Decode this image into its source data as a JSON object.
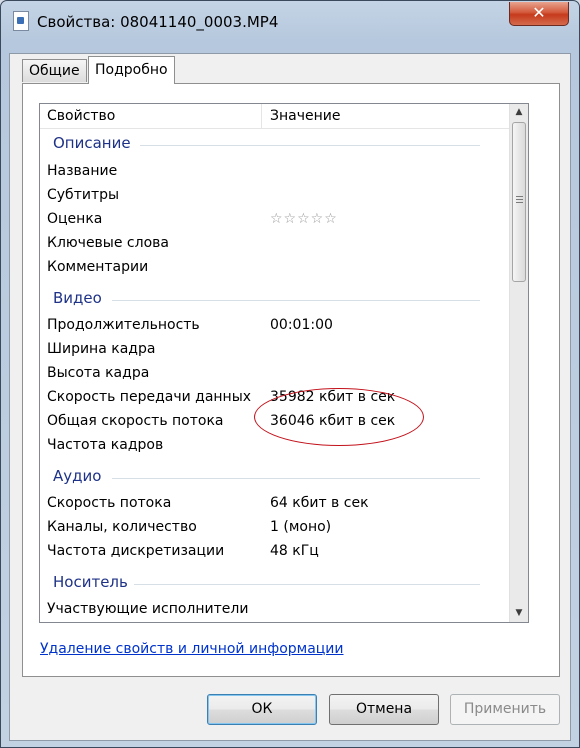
{
  "window": {
    "title": "Свойства: 08041140_0003.MP4",
    "close_glyph": "✕"
  },
  "tabs": [
    {
      "label": "Общие",
      "active": false
    },
    {
      "label": "Подробно",
      "active": true
    }
  ],
  "list": {
    "columns": {
      "property": "Свойство",
      "value": "Значение"
    },
    "groups": {
      "description": {
        "title": "Описание",
        "rows": [
          {
            "name": "Название",
            "value": ""
          },
          {
            "name": "Субтитры",
            "value": ""
          },
          {
            "name": "Оценка",
            "value": "☆☆☆☆☆"
          },
          {
            "name": "Ключевые слова",
            "value": ""
          },
          {
            "name": "Комментарии",
            "value": ""
          }
        ]
      },
      "video": {
        "title": "Видео",
        "rows": [
          {
            "name": "Продолжительность",
            "value": "00:01:00"
          },
          {
            "name": "Ширина кадра",
            "value": ""
          },
          {
            "name": "Высота кадра",
            "value": ""
          },
          {
            "name": "Скорость передачи данных",
            "value": "35982 кбит в сек"
          },
          {
            "name": "Общая скорость потока",
            "value": "36046 кбит в сек"
          },
          {
            "name": "Частота кадров",
            "value": ""
          }
        ]
      },
      "audio": {
        "title": "Аудио",
        "rows": [
          {
            "name": "Скорость потока",
            "value": "64 кбит в сек"
          },
          {
            "name": "Каналы, количество",
            "value": "1 (моно)"
          },
          {
            "name": "Частота дискретизации",
            "value": "48 кГц"
          }
        ]
      },
      "media": {
        "title": "Носитель",
        "rows": [
          {
            "name": "Участвующие исполнители",
            "value": ""
          }
        ]
      }
    }
  },
  "remove_link": "Удаление свойств и личной информации",
  "buttons": {
    "ok": "ОК",
    "cancel": "Отмена",
    "apply": "Применить"
  },
  "colors": {
    "group_heading": "#1e3287",
    "link": "#0033cc",
    "annotation": "#c2121b"
  }
}
